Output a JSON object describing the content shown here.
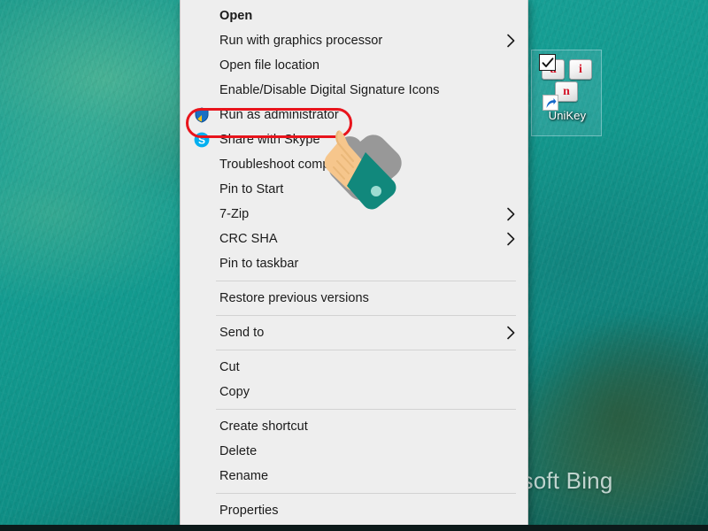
{
  "desktop": {
    "wallpaper_watermark": "rosoft Bing",
    "wallpaper_colors": {
      "primary": "#13998e",
      "dark": "#0d5b52",
      "accent": "#1c9b8d"
    },
    "icon": {
      "label": "UniKey",
      "keys": [
        "u",
        "i",
        "n"
      ],
      "key_color": "#d4182b",
      "checkbox_checked": true,
      "is_shortcut": true,
      "selected": true
    }
  },
  "context_menu": {
    "background": "#eeeeee",
    "items": [
      {
        "label": "Open",
        "bold": true,
        "icon": null,
        "submenu": false,
        "separator_after": false
      },
      {
        "label": "Run with graphics processor",
        "bold": false,
        "icon": null,
        "submenu": true,
        "separator_after": false
      },
      {
        "label": "Open file location",
        "bold": false,
        "icon": null,
        "submenu": false,
        "separator_after": false
      },
      {
        "label": "Enable/Disable Digital Signature Icons",
        "bold": false,
        "icon": null,
        "submenu": false,
        "separator_after": false
      },
      {
        "label": "Run as administrator",
        "bold": false,
        "icon": "uac-shield-icon",
        "submenu": false,
        "separator_after": false
      },
      {
        "label": "Share with Skype",
        "bold": false,
        "icon": "skype-icon",
        "submenu": false,
        "separator_after": false
      },
      {
        "label": "Troubleshoot compatibility",
        "bold": false,
        "icon": null,
        "submenu": false,
        "separator_after": false
      },
      {
        "label": "Pin to Start",
        "bold": false,
        "icon": null,
        "submenu": false,
        "separator_after": false
      },
      {
        "label": "7-Zip",
        "bold": false,
        "icon": null,
        "submenu": true,
        "separator_after": false
      },
      {
        "label": "CRC SHA",
        "bold": false,
        "icon": null,
        "submenu": true,
        "separator_after": false
      },
      {
        "label": "Pin to taskbar",
        "bold": false,
        "icon": null,
        "submenu": false,
        "separator_after": true
      },
      {
        "label": "Restore previous versions",
        "bold": false,
        "icon": null,
        "submenu": false,
        "separator_after": true
      },
      {
        "label": "Send to",
        "bold": false,
        "icon": null,
        "submenu": true,
        "separator_after": true
      },
      {
        "label": "Cut",
        "bold": false,
        "icon": null,
        "submenu": false,
        "separator_after": false
      },
      {
        "label": "Copy",
        "bold": false,
        "icon": null,
        "submenu": false,
        "separator_after": true
      },
      {
        "label": "Create shortcut",
        "bold": false,
        "icon": null,
        "submenu": false,
        "separator_after": false
      },
      {
        "label": "Delete",
        "bold": false,
        "icon": null,
        "submenu": false,
        "separator_after": false
      },
      {
        "label": "Rename",
        "bold": false,
        "icon": null,
        "submenu": false,
        "separator_after": true
      },
      {
        "label": "Properties",
        "bold": false,
        "icon": null,
        "submenu": false,
        "separator_after": false
      }
    ]
  },
  "annotation": {
    "highlight_target": "Run as administrator",
    "highlight_color": "#e8141c",
    "cursor": "pointing-hand-cursor",
    "cursor_skin_color": "#f6c68c",
    "cursor_cuff_color": "#11887c"
  }
}
